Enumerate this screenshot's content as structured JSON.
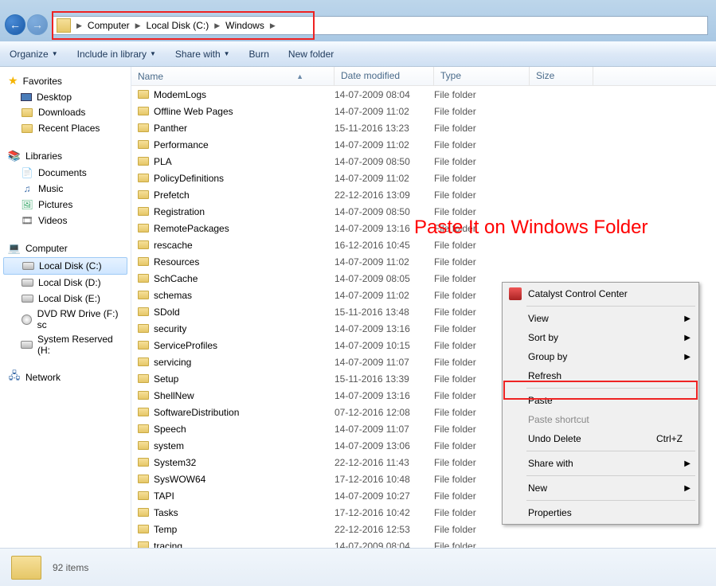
{
  "breadcrumbs": [
    "Computer",
    "Local Disk (C:)",
    "Windows"
  ],
  "toolbar": {
    "organize": "Organize",
    "include": "Include in library",
    "share": "Share with",
    "burn": "Burn",
    "newfolder": "New folder"
  },
  "sidebar": {
    "favorites": {
      "label": "Favorites",
      "items": [
        "Desktop",
        "Downloads",
        "Recent Places"
      ]
    },
    "libraries": {
      "label": "Libraries",
      "items": [
        "Documents",
        "Music",
        "Pictures",
        "Videos"
      ]
    },
    "computer": {
      "label": "Computer",
      "items": [
        "Local Disk (C:)",
        "Local Disk (D:)",
        "Local Disk (E:)",
        "DVD RW Drive (F:) sc",
        "System Reserved (H:"
      ]
    },
    "network": {
      "label": "Network"
    }
  },
  "columns": {
    "name": "Name",
    "date": "Date modified",
    "type": "Type",
    "size": "Size"
  },
  "filetype": "File folder",
  "files": [
    {
      "name": "ModemLogs",
      "date": "14-07-2009 08:04"
    },
    {
      "name": "Offline Web Pages",
      "date": "14-07-2009 11:02"
    },
    {
      "name": "Panther",
      "date": "15-11-2016 13:23"
    },
    {
      "name": "Performance",
      "date": "14-07-2009 11:02"
    },
    {
      "name": "PLA",
      "date": "14-07-2009 08:50"
    },
    {
      "name": "PolicyDefinitions",
      "date": "14-07-2009 11:02"
    },
    {
      "name": "Prefetch",
      "date": "22-12-2016 13:09"
    },
    {
      "name": "Registration",
      "date": "14-07-2009 08:50"
    },
    {
      "name": "RemotePackages",
      "date": "14-07-2009 13:16"
    },
    {
      "name": "rescache",
      "date": "16-12-2016 10:45"
    },
    {
      "name": "Resources",
      "date": "14-07-2009 11:02"
    },
    {
      "name": "SchCache",
      "date": "14-07-2009 08:05"
    },
    {
      "name": "schemas",
      "date": "14-07-2009 11:02"
    },
    {
      "name": "SDold",
      "date": "15-11-2016 13:48"
    },
    {
      "name": "security",
      "date": "14-07-2009 13:16"
    },
    {
      "name": "ServiceProfiles",
      "date": "14-07-2009 10:15"
    },
    {
      "name": "servicing",
      "date": "14-07-2009 11:07"
    },
    {
      "name": "Setup",
      "date": "15-11-2016 13:39"
    },
    {
      "name": "ShellNew",
      "date": "14-07-2009 13:16"
    },
    {
      "name": "SoftwareDistribution",
      "date": "07-12-2016 12:08"
    },
    {
      "name": "Speech",
      "date": "14-07-2009 11:07"
    },
    {
      "name": "system",
      "date": "14-07-2009 13:06"
    },
    {
      "name": "System32",
      "date": "22-12-2016 11:43"
    },
    {
      "name": "SysWOW64",
      "date": "17-12-2016 10:48"
    },
    {
      "name": "TAPI",
      "date": "14-07-2009 10:27"
    },
    {
      "name": "Tasks",
      "date": "17-12-2016 10:42"
    },
    {
      "name": "Temp",
      "date": "22-12-2016 12:53"
    },
    {
      "name": "tracing",
      "date": "14-07-2009 08:04"
    }
  ],
  "context_menu": {
    "ccc": "Catalyst Control Center",
    "view": "View",
    "sortby": "Sort by",
    "groupby": "Group by",
    "refresh": "Refresh",
    "paste": "Paste",
    "paste_shortcut": "Paste shortcut",
    "undo": "Undo Delete",
    "undo_key": "Ctrl+Z",
    "sharewith": "Share with",
    "new": "New",
    "properties": "Properties"
  },
  "status": {
    "count": "92 items"
  },
  "annotation": "Paste It on Windows Folder"
}
